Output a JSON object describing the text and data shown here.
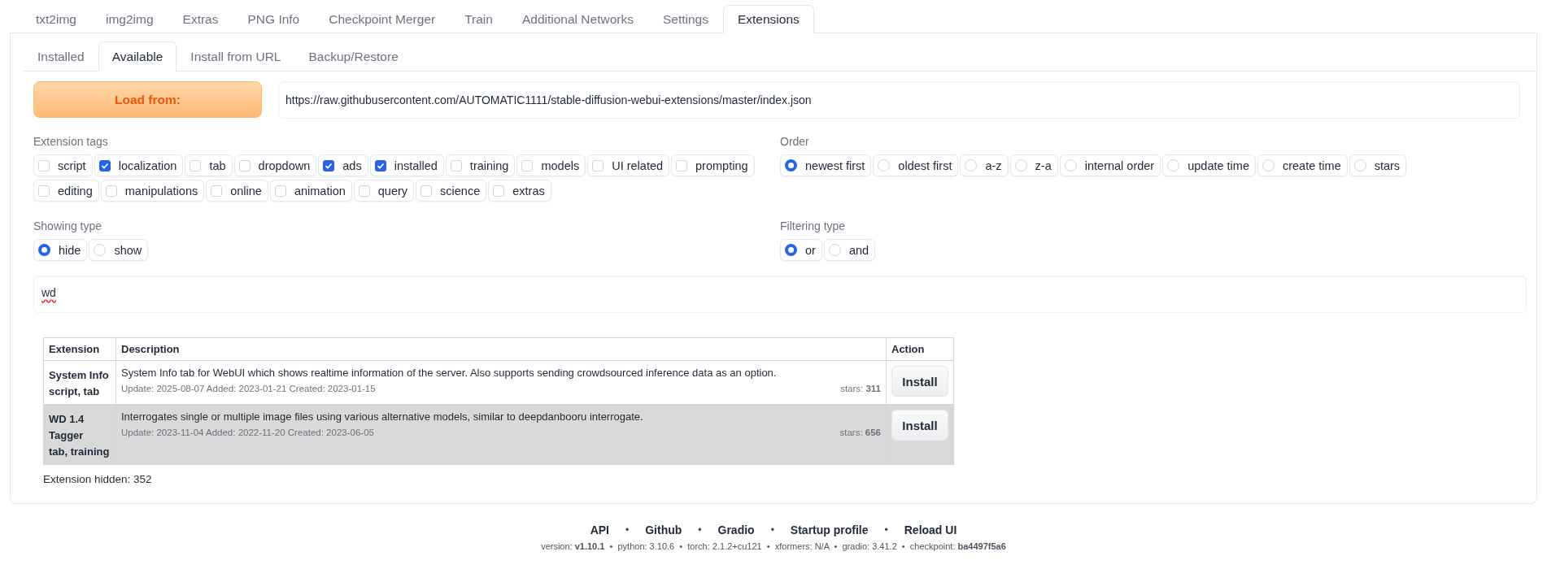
{
  "top_tabs": [
    {
      "label": "txt2img",
      "selected": false
    },
    {
      "label": "img2img",
      "selected": false
    },
    {
      "label": "Extras",
      "selected": false
    },
    {
      "label": "PNG Info",
      "selected": false
    },
    {
      "label": "Checkpoint Merger",
      "selected": false
    },
    {
      "label": "Train",
      "selected": false
    },
    {
      "label": "Additional Networks",
      "selected": false
    },
    {
      "label": "Settings",
      "selected": false
    },
    {
      "label": "Extensions",
      "selected": true
    }
  ],
  "sub_tabs": [
    {
      "label": "Installed",
      "selected": false
    },
    {
      "label": "Available",
      "selected": true
    },
    {
      "label": "Install from URL",
      "selected": false
    },
    {
      "label": "Backup/Restore",
      "selected": false
    }
  ],
  "load_button": "Load from:",
  "url_field": {
    "value": "https://raw.githubusercontent.com/AUTOMATIC1111/stable-diffusion-webui-extensions/master/index.json"
  },
  "extension_tags": {
    "label": "Extension tags",
    "options": [
      {
        "label": "script",
        "checked": false
      },
      {
        "label": "localization",
        "checked": true
      },
      {
        "label": "tab",
        "checked": false
      },
      {
        "label": "dropdown",
        "checked": false
      },
      {
        "label": "ads",
        "checked": true
      },
      {
        "label": "installed",
        "checked": true
      },
      {
        "label": "training",
        "checked": false
      },
      {
        "label": "models",
        "checked": false
      },
      {
        "label": "UI related",
        "checked": false
      },
      {
        "label": "prompting",
        "checked": false
      },
      {
        "label": "editing",
        "checked": false
      },
      {
        "label": "manipulations",
        "checked": false
      },
      {
        "label": "online",
        "checked": false
      },
      {
        "label": "animation",
        "checked": false
      },
      {
        "label": "query",
        "checked": false
      },
      {
        "label": "science",
        "checked": false
      },
      {
        "label": "extras",
        "checked": false
      }
    ]
  },
  "order": {
    "label": "Order",
    "options": [
      {
        "label": "newest first",
        "selected": true
      },
      {
        "label": "oldest first",
        "selected": false
      },
      {
        "label": "a-z",
        "selected": false
      },
      {
        "label": "z-a",
        "selected": false
      },
      {
        "label": "internal order",
        "selected": false
      },
      {
        "label": "update time",
        "selected": false
      },
      {
        "label": "create time",
        "selected": false
      },
      {
        "label": "stars",
        "selected": false
      }
    ]
  },
  "showing_type": {
    "label": "Showing type",
    "options": [
      {
        "label": "hide",
        "selected": true
      },
      {
        "label": "show",
        "selected": false
      }
    ]
  },
  "filtering_type": {
    "label": "Filtering type",
    "options": [
      {
        "label": "or",
        "selected": true
      },
      {
        "label": "and",
        "selected": false
      }
    ]
  },
  "search_field": {
    "value": "wd"
  },
  "table": {
    "columns": [
      "Extension",
      "Description",
      "Action"
    ],
    "rows": [
      {
        "name": "System Info",
        "tags": "script, tab",
        "description": "System Info tab for WebUI which shows realtime information of the server. Also supports sending crowdsourced inference data as an option.",
        "dates": "Update: 2025-08-07 Added: 2023-01-21 Created: 2023-01-15",
        "stars": "stars: **311**",
        "action": "Install",
        "highlighted": false
      },
      {
        "name": "WD 1.4 Tagger",
        "tags": "tab, training",
        "description": "Interrogates single or multiple image files using various alternative models, similar to deepdanbooru interrogate.",
        "dates": "Update: 2023-11-04 Added: 2022-11-20 Created: 2023-06-05",
        "stars": "stars: **656**",
        "action": "Install",
        "highlighted": true
      }
    ]
  },
  "hidden_count": "Extension hidden: 352",
  "footer": {
    "links": [
      {
        "kind": "link",
        "text": "API"
      },
      {
        "kind": "separator",
        "text": "•"
      },
      {
        "kind": "link",
        "text": "Github"
      },
      {
        "kind": "separator",
        "text": "•"
      },
      {
        "kind": "link",
        "text": "Gradio"
      },
      {
        "kind": "separator",
        "text": "•"
      },
      {
        "kind": "link",
        "text": "Startup profile"
      },
      {
        "kind": "separator",
        "text": "•"
      },
      {
        "kind": "link",
        "text": "Reload UI"
      }
    ],
    "versions": "version: **v1.10.1**  •  python: 3.10.6  •  torch: 2.1.2+cu121  •  xformers: N/A  •  gradio: 3.41.2  •  checkpoint: **ba4497f5a6**"
  }
}
